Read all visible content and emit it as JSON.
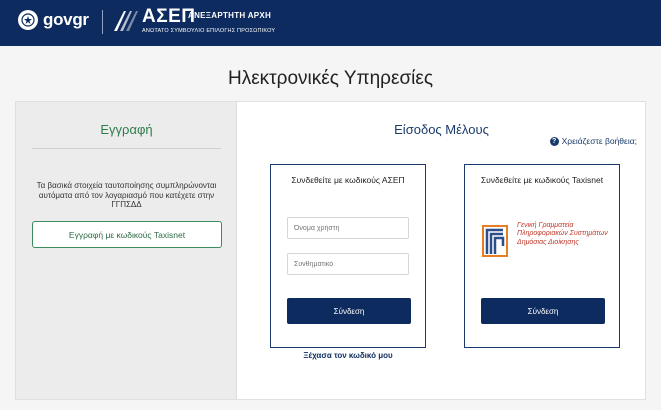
{
  "header": {
    "gov_logo_text": "gov",
    "gov_logo_suffix": "gr",
    "asep_title": "ΑΣΕΠ",
    "asep_subtitle": "ΑΝΕΞΑΡΤΗΤΗ ΑΡΧΗ",
    "asep_tagline": "ΑΝΩΤΑΤΟ ΣΥΜΒΟΥΛΙΟ ΕΠΙΛΟΓΗΣ ΠΡΟΣΩΠΙΚΟΥ",
    "bg_color": "#0d2b5e"
  },
  "page": {
    "title": "Ηλεκτρονικές Υπηρεσίες"
  },
  "registration": {
    "title": "Εγγραφή",
    "description": "Τα βασικά στοιχεία ταυτοποίησης συμπληρώνονται αυτόματα από τον λογαριασμό που κατέχετε στην ΓΓΠΣΔΔ",
    "button_label": "Εγγραφή με κωδικούς Taxisnet",
    "accent_color": "#2e7d4f"
  },
  "login": {
    "title": "Είσοδος Μέλους",
    "help_link": "Χρειάζεστε βοήθεια;",
    "asep_box": {
      "title": "Συνδεθείτε με κωδικούς ΑΣΕΠ",
      "username_placeholder": "Όνομα χρήστη",
      "password_placeholder": "Συνθηματικό",
      "submit_label": "Σύνδεση",
      "forgot_link": "Ξέχασα τον κωδικό μου"
    },
    "taxis_box": {
      "title": "Συνδεθείτε με κωδικούς Taxisnet",
      "logo_text": "Γενική Γραμματεία Πληροφοριακών Συστημάτων Δημόσιας Διοίκησης",
      "submit_label": "Σύνδεση"
    },
    "accent_color": "#0d2b5e"
  }
}
